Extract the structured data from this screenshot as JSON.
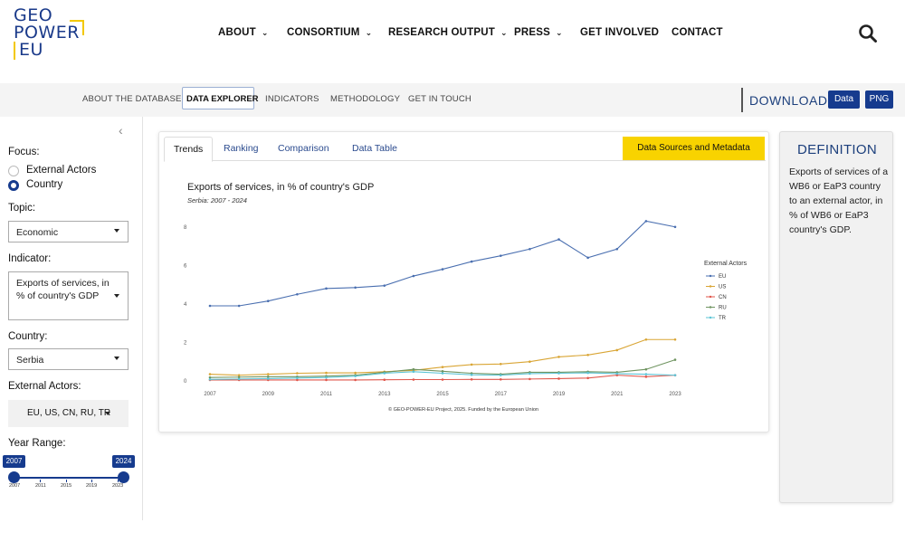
{
  "logo": {
    "line1": "GEO",
    "line2": "POWER",
    "line3": "EU"
  },
  "nav": {
    "items": [
      {
        "label": "ABOUT",
        "dropdown": true
      },
      {
        "label": "CONSORTIUM",
        "dropdown": true
      },
      {
        "label": "RESEARCH OUTPUT",
        "dropdown": true
      },
      {
        "label": "PRESS",
        "dropdown": true
      },
      {
        "label": "GET INVOLVED",
        "dropdown": false
      },
      {
        "label": "CONTACT",
        "dropdown": false
      }
    ],
    "search_icon": "search-icon"
  },
  "subnav": {
    "items": [
      "ABOUT THE DATABASE",
      "DATA EXPLORER",
      "INDICATORS",
      "METHODOLOGY",
      "GET IN TOUCH"
    ],
    "active": "DATA EXPLORER",
    "download_label": "DOWNLOAD",
    "download_data": "Data",
    "download_png": "PNG"
  },
  "sidebar": {
    "collapse_icon": "chevron-left-icon",
    "focus_label": "Focus:",
    "focus_options": [
      "External Actors",
      "Country"
    ],
    "focus_selected": "Country",
    "topic_label": "Topic:",
    "topic_value": "Economic",
    "indicator_label": "Indicator:",
    "indicator_value": "Exports of services, in % of country's GDP",
    "country_label": "Country:",
    "country_value": "Serbia",
    "actors_label": "External Actors:",
    "actors_value": "EU, US, CN, RU, TR",
    "year_label": "Year Range:",
    "year_start": "2007",
    "year_end": "2024",
    "year_ticks": [
      "2007",
      "2011",
      "2015",
      "2019",
      "2023"
    ]
  },
  "tabs": [
    "Trends",
    "Ranking",
    "Comparison",
    "Data Table"
  ],
  "active_tab": "Trends",
  "data_sources_button": "Data Sources and Metadata",
  "chart_data": {
    "type": "line",
    "title": "Exports of services, in % of country's GDP",
    "subtitle": "Serbia: 2007 - 2024",
    "x": [
      2007,
      2008,
      2009,
      2010,
      2011,
      2012,
      2013,
      2014,
      2015,
      2016,
      2017,
      2018,
      2019,
      2020,
      2021,
      2022,
      2023
    ],
    "x_tick_labels": [
      "2007",
      "2009",
      "2011",
      "2013",
      "2015",
      "2017",
      "2019",
      "2021",
      "2023"
    ],
    "y_tick_labels": [
      "0",
      "2",
      "4",
      "6",
      "8"
    ],
    "ylim": [
      0,
      8.6
    ],
    "legend_title": "External Actors",
    "legend_position": "right",
    "grid": false,
    "series": [
      {
        "name": "EU",
        "color": "#4a6fb0",
        "values": [
          3.9,
          3.9,
          4.15,
          4.5,
          4.8,
          4.85,
          4.95,
          5.45,
          5.8,
          6.2,
          6.5,
          6.85,
          7.35,
          6.4,
          6.85,
          8.3,
          8.0
        ]
      },
      {
        "name": "US",
        "color": "#d9a534",
        "values": [
          0.35,
          0.3,
          0.35,
          0.4,
          0.42,
          0.42,
          0.48,
          0.55,
          0.72,
          0.85,
          0.88,
          1.0,
          1.25,
          1.35,
          1.6,
          2.15,
          2.15
        ]
      },
      {
        "name": "CN",
        "color": "#e0564b",
        "values": [
          0.05,
          0.05,
          0.05,
          0.05,
          0.05,
          0.05,
          0.06,
          0.07,
          0.07,
          0.08,
          0.08,
          0.1,
          0.12,
          0.15,
          0.3,
          0.22,
          0.3
        ]
      },
      {
        "name": "RU",
        "color": "#6f9460",
        "values": [
          0.18,
          0.2,
          0.22,
          0.22,
          0.25,
          0.3,
          0.45,
          0.6,
          0.5,
          0.4,
          0.35,
          0.45,
          0.45,
          0.48,
          0.45,
          0.6,
          1.1
        ]
      },
      {
        "name": "TR",
        "color": "#5bc4d6",
        "values": [
          0.08,
          0.1,
          0.12,
          0.15,
          0.18,
          0.25,
          0.4,
          0.48,
          0.4,
          0.32,
          0.3,
          0.38,
          0.4,
          0.42,
          0.38,
          0.35,
          0.3
        ]
      }
    ],
    "footer": "© GEO-POWER-EU Project, 2025. Funded by the European Union"
  },
  "definition": {
    "heading": "DEFINITION",
    "text": "Exports of services of a WB6 or EaP3 country to an external actor, in % of WB6 or EaP3 country's GDP."
  }
}
